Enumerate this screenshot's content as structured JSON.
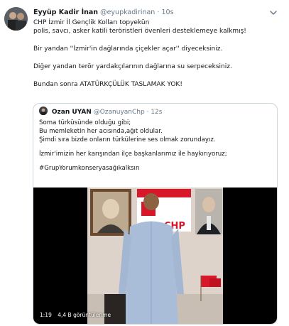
{
  "tweet": {
    "author_name": "Eyyüp Kadir İnan",
    "author_handle": "@eyupkadirinan",
    "separator": "·",
    "time": "10s",
    "lines": [
      "CHP İzmir İl Gençlik Kolları topyekün",
      "polis, savcı, asker katili teröristleri övenleri desteklemeye kalkmış!",
      "",
      "Bir yandan ''İzmir'in dağlarında çiçekler açar'' diyeceksiniz.",
      "",
      "Diğer yandan terör yardakçılarının dağlarına su serpeceksiniz.",
      "",
      "Bundan sonra ATATÜRKÇÜLÜK TASLAMAK YOK!"
    ]
  },
  "quote": {
    "author_name": "Ozan UYAN",
    "author_handle": "@OzanuyanChp",
    "separator": "·",
    "time": "12s",
    "lines": [
      "Soma türküsünde olduğu gibi;",
      "Bu memleketin her acısında,ağıt oldular.",
      "Şimdi sıra bizde onların türkülerine ses olmak zorundayız.",
      "",
      "İzmir'imizin her karışından ilçe başkanlarımız ile haykırıyoruz;",
      "",
      "#GrupYorumkonseryasağıkalksın"
    ],
    "video": {
      "duration": "1:19",
      "views": "4,4 B görüntülenme",
      "sign_text": "CHP"
    }
  },
  "colors": {
    "text": "#14171a",
    "secondary": "#657786",
    "border": "#ccd6dd",
    "chp_red": "#d7182a"
  },
  "icons": {
    "menu": "chevron-down-icon"
  }
}
